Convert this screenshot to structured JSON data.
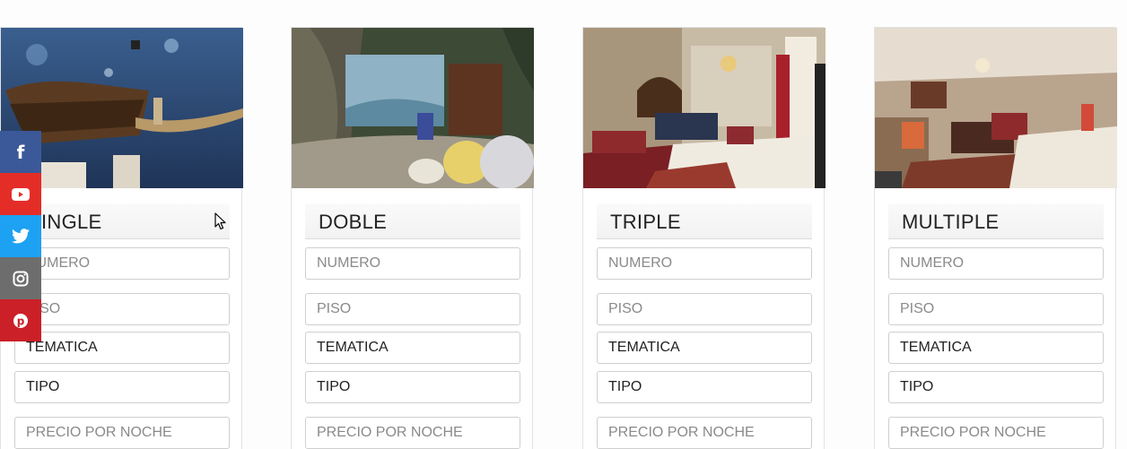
{
  "rooms": [
    {
      "title": "SINGLE",
      "numero_placeholder": "NUMERO",
      "piso_placeholder": "PISO",
      "tematica_value": "TEMATICA",
      "tipo_value": "TIPO",
      "precio_placeholder": "PRECIO POR NOCHE"
    },
    {
      "title": "DOBLE",
      "numero_placeholder": "NUMERO",
      "piso_placeholder": "PISO",
      "tematica_value": "TEMATICA",
      "tipo_value": "TIPO",
      "precio_placeholder": "PRECIO POR NOCHE"
    },
    {
      "title": "TRIPLE",
      "numero_placeholder": "NUMERO",
      "piso_placeholder": "PISO",
      "tematica_value": "TEMATICA",
      "tipo_value": "TIPO",
      "precio_placeholder": "PRECIO POR NOCHE"
    },
    {
      "title": "MULTIPLE",
      "numero_placeholder": "NUMERO",
      "piso_placeholder": "PISO",
      "tematica_value": "TEMATICA",
      "tipo_value": "TIPO",
      "precio_placeholder": "PRECIO POR NOCHE"
    }
  ],
  "social": [
    {
      "icon": "facebook-icon",
      "glyph": "f",
      "color": "#3b5998"
    },
    {
      "icon": "youtube-icon",
      "glyph": "",
      "color": "#e52d27"
    },
    {
      "icon": "twitter-icon",
      "glyph": "",
      "color": "#1da1f2"
    },
    {
      "icon": "instagram-icon",
      "glyph": "",
      "color": "#6d6d6d"
    },
    {
      "icon": "pinterest-icon",
      "glyph": "",
      "color": "#cb2027"
    }
  ]
}
